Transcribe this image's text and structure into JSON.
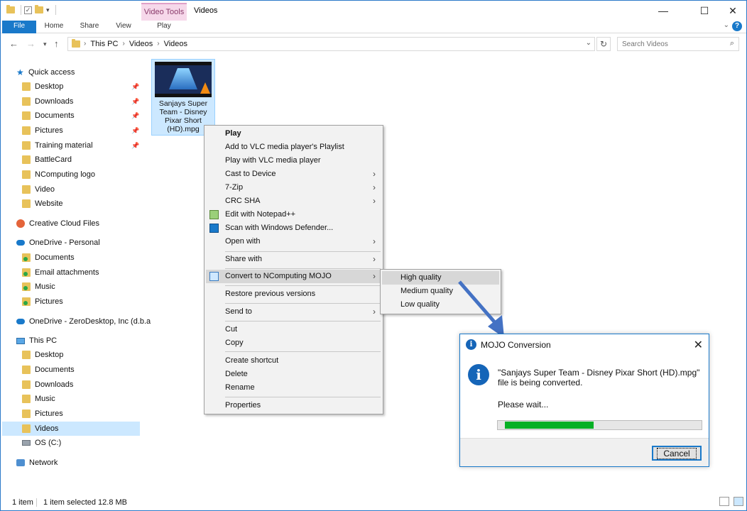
{
  "window": {
    "title": "Videos",
    "contextual_tab_group": "Video Tools",
    "controls": {
      "minimize": "—",
      "maximize": "☐",
      "close": "✕"
    }
  },
  "ribbon": {
    "tabs": [
      "File",
      "Home",
      "Share",
      "View",
      "Play"
    ]
  },
  "address": {
    "crumbs": [
      "This PC",
      "Videos",
      "Videos"
    ],
    "search_placeholder": "Search Videos"
  },
  "nav": {
    "quick_access": "Quick access",
    "quick_items": [
      "Desktop",
      "Downloads",
      "Documents",
      "Pictures",
      "Training material",
      "BattleCard",
      "NComputing logo",
      "Video",
      "Website"
    ],
    "creative_cloud": "Creative Cloud Files",
    "onedrive_personal": "OneDrive - Personal",
    "onedrive_items": [
      "Documents",
      "Email attachments",
      "Music",
      "Pictures"
    ],
    "onedrive_zero": "OneDrive - ZeroDesktop, Inc (d.b.a",
    "this_pc": "This PC",
    "pc_items": [
      "Desktop",
      "Documents",
      "Downloads",
      "Music",
      "Pictures",
      "Videos",
      "OS (C:)"
    ],
    "network": "Network"
  },
  "file": {
    "name": "Sanjays Super Team - Disney Pixar Short (HD).mpg"
  },
  "context_menu": {
    "items": [
      "Play",
      "Add to VLC media player's Playlist",
      "Play with VLC media player",
      "Cast to Device",
      "7-Zip",
      "CRC SHA",
      "Edit with Notepad++",
      "Scan with Windows Defender...",
      "Open with",
      "Share with",
      "Convert to NComputing MOJO",
      "Restore previous versions",
      "Send to",
      "Cut",
      "Copy",
      "Create shortcut",
      "Delete",
      "Rename",
      "Properties"
    ],
    "submenu": [
      "High quality",
      "Medium quality",
      "Low quality"
    ]
  },
  "dialog": {
    "title": "MOJO Conversion",
    "message": "\"Sanjays Super Team - Disney Pixar Short (HD).mpg\" file is being converted.",
    "wait": "Please wait...",
    "progress": 0.45,
    "cancel": "Cancel"
  },
  "status": {
    "count": "1 item",
    "selected": "1 item selected  12.8 MB"
  },
  "colors": {
    "accent": "#1979ca",
    "selection": "#cce8ff",
    "progress": "#06b025",
    "arrow": "#4472c4"
  }
}
